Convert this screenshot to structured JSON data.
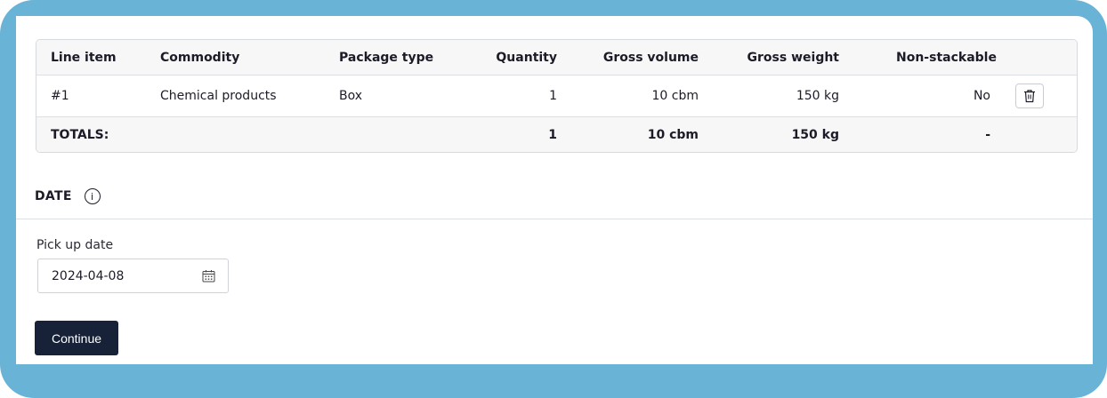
{
  "table": {
    "headers": {
      "line_item": "Line item",
      "commodity": "Commodity",
      "package_type": "Package type",
      "quantity": "Quantity",
      "gross_volume": "Gross volume",
      "gross_weight": "Gross weight",
      "non_stackable": "Non-stackable"
    },
    "rows": [
      {
        "line_item": "#1",
        "commodity": "Chemical products",
        "package_type": "Box",
        "quantity": "1",
        "gross_volume": "10 cbm",
        "gross_weight": "150 kg",
        "non_stackable": "No",
        "delete_icon": "trash-icon"
      }
    ],
    "totals": {
      "label": "TOTALS:",
      "quantity": "1",
      "gross_volume": "10 cbm",
      "gross_weight": "150 kg",
      "non_stackable": "-"
    }
  },
  "date_section": {
    "title": "DATE",
    "info_icon": "info-icon",
    "pickup_label": "Pick up date",
    "pickup_value": "2024-04-08",
    "calendar_icon": "calendar-icon"
  },
  "actions": {
    "continue_label": "Continue"
  },
  "colors": {
    "frame": "#69b3d6",
    "button_bg": "#172239",
    "header_bg": "#f7f7f7",
    "border": "#dcdfe3"
  }
}
